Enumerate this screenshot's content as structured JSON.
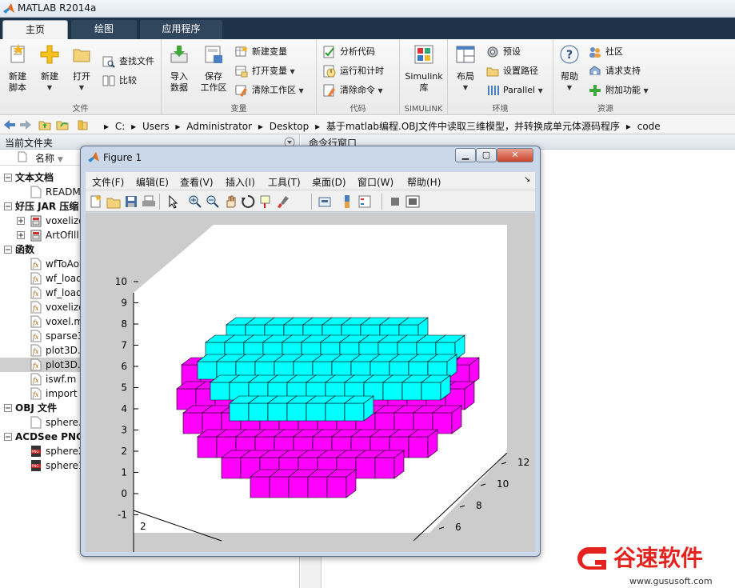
{
  "app": {
    "title": "MATLAB R2014a"
  },
  "tabs": [
    {
      "label": "主页"
    },
    {
      "label": "绘图"
    },
    {
      "label": "应用程序"
    }
  ],
  "ribbon": {
    "file": {
      "group": "文件",
      "new_script": "新建\n脚本",
      "new": "新建",
      "open": "打开",
      "find_files": "查找文件",
      "compare": "比较"
    },
    "variable": {
      "group": "变量",
      "import": "导入\n数据",
      "save_ws": "保存\n工作区",
      "new_var": "新建变量",
      "open_var": "打开变量",
      "clear_ws": "清除工作区"
    },
    "code": {
      "group": "代码",
      "analyze": "分析代码",
      "run_time": "运行和计时",
      "clear_cmd": "清除命令"
    },
    "simulink": {
      "group": "SIMULINK",
      "lib": "Simulink\n库"
    },
    "env": {
      "group": "环境",
      "layout": "布局",
      "prefs": "预设",
      "set_path": "设置路径",
      "parallel": "Parallel"
    },
    "resources": {
      "group": "资源",
      "help": "帮助",
      "community": "社区",
      "support": "请求支持",
      "addons": "附加功能"
    }
  },
  "address": {
    "crumbs": [
      "C:",
      "Users",
      "Administrator",
      "Desktop",
      "基于matlab编程.OBJ文件中读取三维模型，并转换成单元体源码程序",
      "code"
    ]
  },
  "left_panel": {
    "title": "当前文件夹",
    "col_name": "名称",
    "items": [
      {
        "kind": "group",
        "label": "文本文档",
        "icon": "minus-icon"
      },
      {
        "kind": "file",
        "label": "READM",
        "icon": "text-file-icon"
      },
      {
        "kind": "group",
        "label": "好压 JAR 压缩",
        "icon": "minus-icon"
      },
      {
        "kind": "file",
        "label": "voxelize",
        "icon": "archive-icon",
        "expand": "plus-icon"
      },
      {
        "kind": "file",
        "label": "ArtOfIll",
        "icon": "archive-icon",
        "expand": "plus-icon"
      },
      {
        "kind": "group",
        "label": "函数",
        "icon": "minus-icon"
      },
      {
        "kind": "file",
        "label": "wfToAo",
        "icon": "function-icon"
      },
      {
        "kind": "file",
        "label": "wf_load",
        "icon": "function-icon"
      },
      {
        "kind": "file",
        "label": "wf_load",
        "icon": "function-icon"
      },
      {
        "kind": "file",
        "label": "voxelize",
        "icon": "function-icon"
      },
      {
        "kind": "file",
        "label": "voxel.m",
        "icon": "function-icon"
      },
      {
        "kind": "file",
        "label": "sparse3",
        "icon": "function-icon"
      },
      {
        "kind": "file",
        "label": "plot3D.",
        "icon": "function-icon"
      },
      {
        "kind": "file",
        "label": "plot3D.",
        "icon": "function-icon",
        "selected": true
      },
      {
        "kind": "file",
        "label": "iswf.m",
        "icon": "function-icon"
      },
      {
        "kind": "file",
        "label": "import",
        "icon": "function-icon"
      },
      {
        "kind": "group",
        "label": "OBJ 文件",
        "icon": "minus-icon"
      },
      {
        "kind": "file",
        "label": "sphere.",
        "icon": "text-file-icon"
      },
      {
        "kind": "group",
        "label": "ACDSee PNG",
        "icon": "minus-icon"
      },
      {
        "kind": "file",
        "label": "sphere2",
        "icon": "png-icon"
      },
      {
        "kind": "file",
        "label": "sphere1",
        "icon": "png-icon"
      }
    ]
  },
  "right_panel": {
    "title": "命令行窗口"
  },
  "figure": {
    "title": "Figure 1",
    "menu": [
      "文件(F)",
      "编辑(E)",
      "查看(V)",
      "插入(I)",
      "工具(T)",
      "桌面(D)",
      "窗口(W)",
      "帮助(H)"
    ],
    "toolbar": [
      "new-figure-icon",
      "open-icon",
      "save-icon",
      "print-icon",
      "pointer-icon",
      "zoom-in-icon",
      "zoom-out-icon",
      "pan-icon",
      "rotate-icon",
      "data-cursor-icon",
      "brush-icon",
      "link-icon",
      "colorbar-icon",
      "legend-icon",
      "hide-plot-tools-icon",
      "show-plot-tools-icon"
    ],
    "z_ticks": [
      "10",
      "9",
      "8",
      "7",
      "6",
      "5",
      "4",
      "3",
      "2",
      "1",
      "0",
      "-1"
    ],
    "x_ticks": [
      "2"
    ],
    "y_ticks": [
      "12",
      "10",
      "8",
      "6"
    ],
    "colors": {
      "top": "#00ffff",
      "body": "#ff00ff",
      "edge": "#000000",
      "axes_bg": "#ffffff",
      "figure_bg": "#cccccc"
    }
  },
  "watermark": {
    "brand": "谷速软件",
    "url": "www.gususoft.com",
    "color": "#e4231f"
  }
}
